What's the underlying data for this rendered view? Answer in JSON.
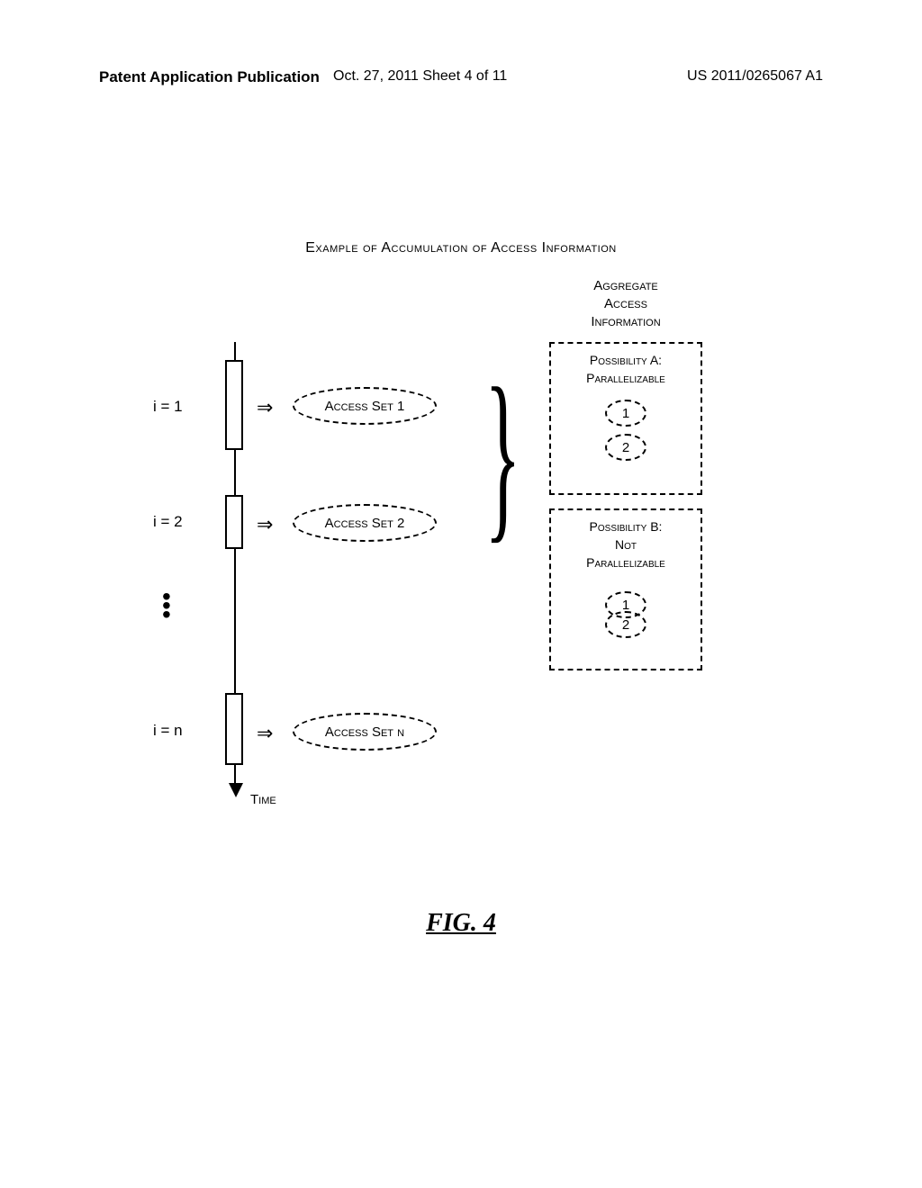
{
  "header": {
    "left": "Patent Application Publication",
    "middle": "Oct. 27, 2011  Sheet 4 of 11",
    "right": "US 2011/0265067 A1"
  },
  "title": "Example of Accumulation of Access Information",
  "iterations": {
    "i1_label": "i = 1",
    "i2_label": "i = 2",
    "in_label": "i = n",
    "dots": "•\n•\n•"
  },
  "time_label": "Time",
  "imply_glyph": "⇒",
  "access_sets": {
    "s1": "Access Set 1",
    "s2": "Access Set 2",
    "sn": "Access Set n"
  },
  "brace_glyph": "}",
  "aggregate": {
    "header": "Aggregate\nAccess\nInformation",
    "possA_title": "Possibility A:\nParallelizable",
    "possB_title": "Possibility B:\nNot\nParallelizable",
    "one": "1",
    "two": "2"
  },
  "figure_label": "FIG. 4"
}
